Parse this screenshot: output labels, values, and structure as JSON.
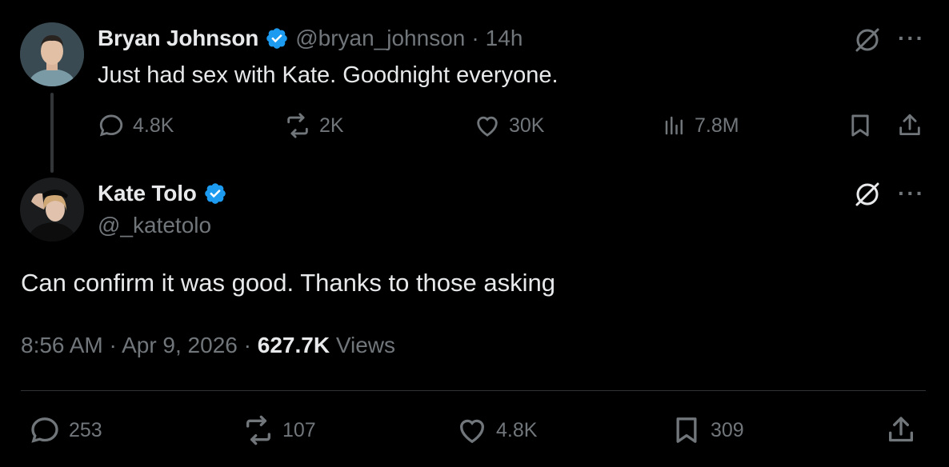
{
  "parent_tweet": {
    "author_name": "Bryan Johnson",
    "author_handle": "@bryan_johnson",
    "separator": "·",
    "time_ago": "14h",
    "text": "Just had sex with Kate. Goodnight everyone.",
    "replies": "4.8K",
    "reposts": "2K",
    "likes": "30K",
    "views": "7.8M"
  },
  "main_tweet": {
    "author_name": "Kate Tolo",
    "author_handle": "@_katetolo",
    "text": "Can confirm it was good. Thanks to those asking",
    "time": "8:56 AM",
    "date": "Apr 9, 2026",
    "separator1": "·",
    "separator2": "·",
    "views_count": "627.7K",
    "views_label": "Views",
    "replies": "253",
    "reposts": "107",
    "likes": "4.8K",
    "bookmarks": "309"
  },
  "icons": {
    "more": "···",
    "verified_color": "#1d9bf0",
    "grok_icon": "grok-icon",
    "reply_icon": "reply-icon",
    "repost_icon": "repost-icon",
    "like_icon": "heart-icon",
    "views_icon": "views-icon",
    "bookmark_icon": "bookmark-icon",
    "share_icon": "share-icon"
  }
}
